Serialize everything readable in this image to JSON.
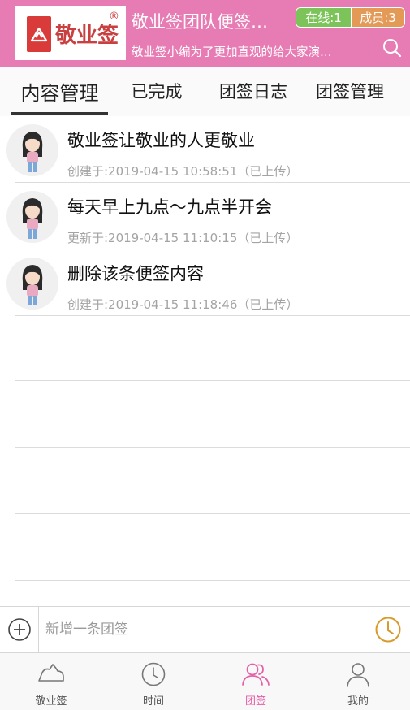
{
  "header": {
    "logo_text": "敬业签",
    "logo_reg": "®",
    "title": "敬业签团队便签…",
    "subtitle": "敬业签小编为了更加直观的给大家演…",
    "online_badge": "在线:1",
    "members_badge": "成员:3"
  },
  "tabs": [
    {
      "label": "内容管理",
      "active": true
    },
    {
      "label": "已完成",
      "active": false
    },
    {
      "label": "团签日志",
      "active": false
    },
    {
      "label": "团签管理",
      "active": false
    }
  ],
  "notes": [
    {
      "title": "敬业签让敬业的人更敬业",
      "meta": "创建于:2019-04-15 10:58:51（已上传）"
    },
    {
      "title": "每天早上九点～九点半开会",
      "meta": "更新于:2019-04-15 11:10:15（已上传）"
    },
    {
      "title": "删除该条便签内容",
      "meta": "创建于:2019-04-15 11:18:46（已上传）"
    }
  ],
  "input": {
    "placeholder": "新增一条团签",
    "value": ""
  },
  "bottom_nav": [
    {
      "label": "敬业签",
      "icon": "cloud-icon",
      "active": false
    },
    {
      "label": "时间",
      "icon": "clock-icon",
      "active": false
    },
    {
      "label": "团签",
      "icon": "team-icon",
      "active": true
    },
    {
      "label": "我的",
      "icon": "person-icon",
      "active": false
    }
  ],
  "colors": {
    "header_bg": "#e77cb4",
    "online_badge": "#7cc35a",
    "members_badge": "#e39a56",
    "active_nav": "#e45fa6",
    "clock_accent": "#d79a2c"
  }
}
